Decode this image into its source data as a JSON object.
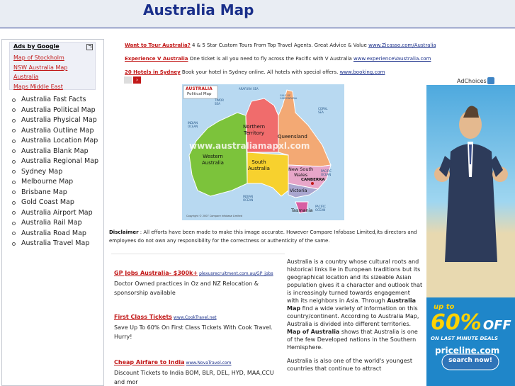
{
  "header": {
    "title": "Australia Map"
  },
  "sidebar": {
    "ads_heading": "Ads by Google",
    "ad_links": [
      "Map of Stockholm",
      "NSW Australia Map",
      "Australia",
      "Maps Middle East"
    ],
    "nav": [
      "Australia Fast Facts",
      "Australia Political Map",
      "Australia Physical Map",
      "Australia Outline Map",
      "Australia Location Map",
      "Australia Blank Map",
      "Australia Regional Map",
      "Sydney Map",
      "Melbourne Map",
      "Brisbane Map",
      "Gold Coast Map",
      "Australia Airport Map",
      "Australia Rail Map",
      "Australia Road Map",
      "Australia Travel Map"
    ]
  },
  "top_ads": [
    {
      "title": "Want to Tour Australia?",
      "desc": " 4 & 5 Star Custom Tours From Top Travel Agents. Great Advice & Value ",
      "url": "www.Zicasso.com/Australia"
    },
    {
      "title": "Experience V Australia",
      "desc": " One ticket is all you need to fly across the Pacific with V Australia ",
      "url": "www.experienceVaustralia.com"
    },
    {
      "title": "20 Hotels in Sydney",
      "desc": " Book your hotel in Sydney online. All hotels with special offers. ",
      "url": "www.booking.com"
    }
  ],
  "adchoices": "AdChoices",
  "map": {
    "badge_title": "AUSTRALIA",
    "badge_sub": "Political Map",
    "watermark": "www.australiamapxl.com",
    "regions": {
      "wa": [
        "Western",
        "Australia"
      ],
      "nt": [
        "Northern",
        "Territory"
      ],
      "qld": "Queensland",
      "sa": [
        "South",
        "Australia"
      ],
      "nsw": [
        "New South",
        "Wales"
      ],
      "vic": "Victoria",
      "tas": "Tasmania",
      "canberra": "CANBERRA"
    },
    "seas": {
      "arafura": "ARAFURA SEA",
      "timor": "TIMOR SEA",
      "coral": "CORAL SEA",
      "indian_w": "INDIAN OCEAN",
      "indian_s": "INDIAN OCEAN",
      "pacific": "PACIFIC OCEAN",
      "pacific2": "PACIFIC OCEAN",
      "gulf": "GULF OF CARPENTARIA"
    },
    "copyright": "Copyright © 2007 Compare Infobase Limited"
  },
  "disclaimer": {
    "label": "Disclaimer",
    "text": " : All efforts have been made to make this image accurate. However Compare Infobase Limited,its directors and employees do not own any responsibility for the correctness or authenticity of the same."
  },
  "left_ads": [
    {
      "title": "GP Jobs Australia- $300k+",
      "url": "plexusrecruitment.com.au/GP_jobs",
      "desc": "Doctor Owned practices in Oz and NZ Relocation & sponsorship available"
    },
    {
      "title": "First Class Tickets",
      "url": "www.CookTravel.net",
      "desc": "Save Up To 60% On First Class Tickets With Cook Travel. Hurry!"
    },
    {
      "title": "Cheap Airfare to India",
      "url": "www.NovaTravel.com",
      "desc": "Discount Tickets to India BOM, BLR, DEL, HYD, MAA,CCU and mor"
    }
  ],
  "article": {
    "p1_a": "Australia is a country whose cultural roots and historical links lie in European traditions but its geographical location and its sizeable Asian population gives it a character and outlook that is increasingly turned towards engagement with its neighbors in Asia. Through ",
    "p1_b": "Australia Map",
    "p1_c": " find a wide variety of information on this country/continent. According to Australia Map, Australia is divided into different territories. ",
    "p1_d": "Map of Australia",
    "p1_e": " shows that Australia is one of the few Developed nations in the Southern Hemisphere.",
    "p2": "Australia is also one of the world's youngest countries that continue to attract"
  },
  "sky_ad": {
    "up_to": "up to",
    "big": "60%",
    "off": "OFF",
    "sub": "ON LAST MINUTE DEALS",
    "brand": "priceline.com",
    "cta": "search now!"
  }
}
